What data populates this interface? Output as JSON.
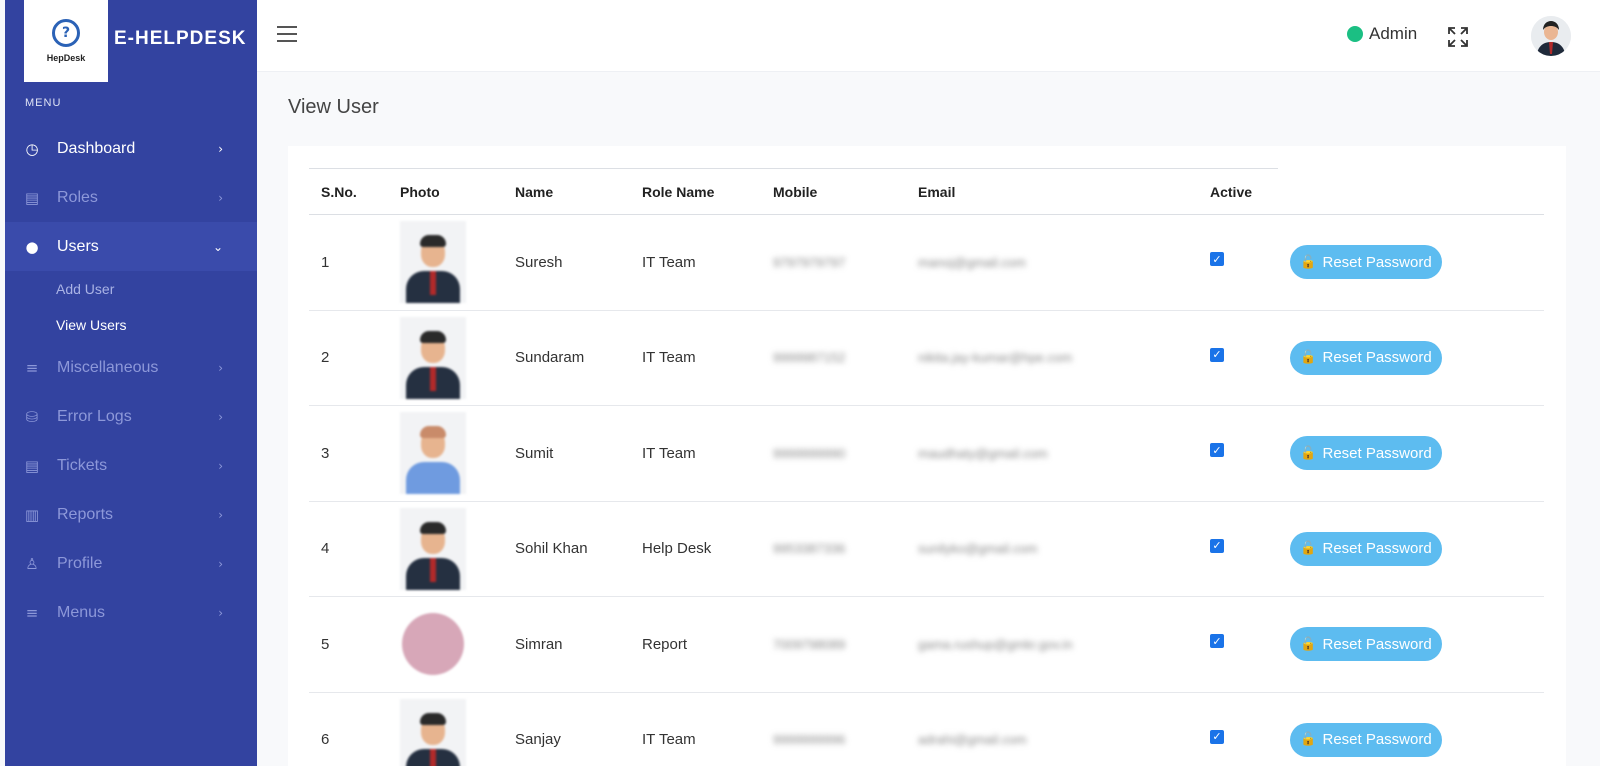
{
  "brand": {
    "logo_text": "HepDesk",
    "name": "E-HELPDESK"
  },
  "sidebar": {
    "menu_label": "MENU",
    "items": [
      {
        "label": "Dashboard",
        "icon": "gauge-icon",
        "glyph": "◷"
      },
      {
        "label": "Roles",
        "icon": "document-icon",
        "glyph": "▤"
      },
      {
        "label": "Users",
        "icon": "user-icon",
        "glyph": "●"
      },
      {
        "label": "Miscellaneous",
        "icon": "list-icon",
        "glyph": "≡"
      },
      {
        "label": "Error Logs",
        "icon": "database-icon",
        "glyph": "⛁"
      },
      {
        "label": "Tickets",
        "icon": "ticket-icon",
        "glyph": "▤"
      },
      {
        "label": "Reports",
        "icon": "bar-chart-icon",
        "glyph": "▥"
      },
      {
        "label": "Profile",
        "icon": "profile-icon",
        "glyph": "♙"
      },
      {
        "label": "Menus",
        "icon": "menu-icon",
        "glyph": "≡"
      }
    ],
    "users_submenu": [
      "Add User",
      "View Users"
    ]
  },
  "header": {
    "user_name": "Admin",
    "status_color": "#1bbf83"
  },
  "page": {
    "title": "View User"
  },
  "table": {
    "columns": [
      "S.No.",
      "Photo",
      "Name",
      "Role Name",
      "Mobile",
      "Email",
      "Active"
    ],
    "reset_label": "Reset Password",
    "rows": [
      {
        "sno": "1",
        "name": "Suresh",
        "role": "IT Team",
        "mobile": "9797979797",
        "email": "manoj@gmail.com"
      },
      {
        "sno": "2",
        "name": "Sundaram",
        "role": "IT Team",
        "mobile": "9999987152",
        "email": "nikita.jay-kumar@hpe.com"
      },
      {
        "sno": "3",
        "name": "Sumit",
        "role": "IT Team",
        "mobile": "9999999990",
        "email": "maudhaty@gmail.com"
      },
      {
        "sno": "4",
        "name": "Sohil Khan",
        "role": "Help Desk",
        "mobile": "9953387336",
        "email": "sunilyko@gmail.com"
      },
      {
        "sno": "5",
        "name": "Simran",
        "role": "Report",
        "mobile": "7009798089",
        "email": "gama.rushup@gmkr.gov.in"
      },
      {
        "sno": "6",
        "name": "Sanjay",
        "role": "IT Team",
        "mobile": "9999999996",
        "email": "adrahi@gmail.com"
      }
    ]
  },
  "colors": {
    "sidebar": "#3343a0",
    "button": "#5dbcf0",
    "checkbox": "#1a73e8"
  }
}
